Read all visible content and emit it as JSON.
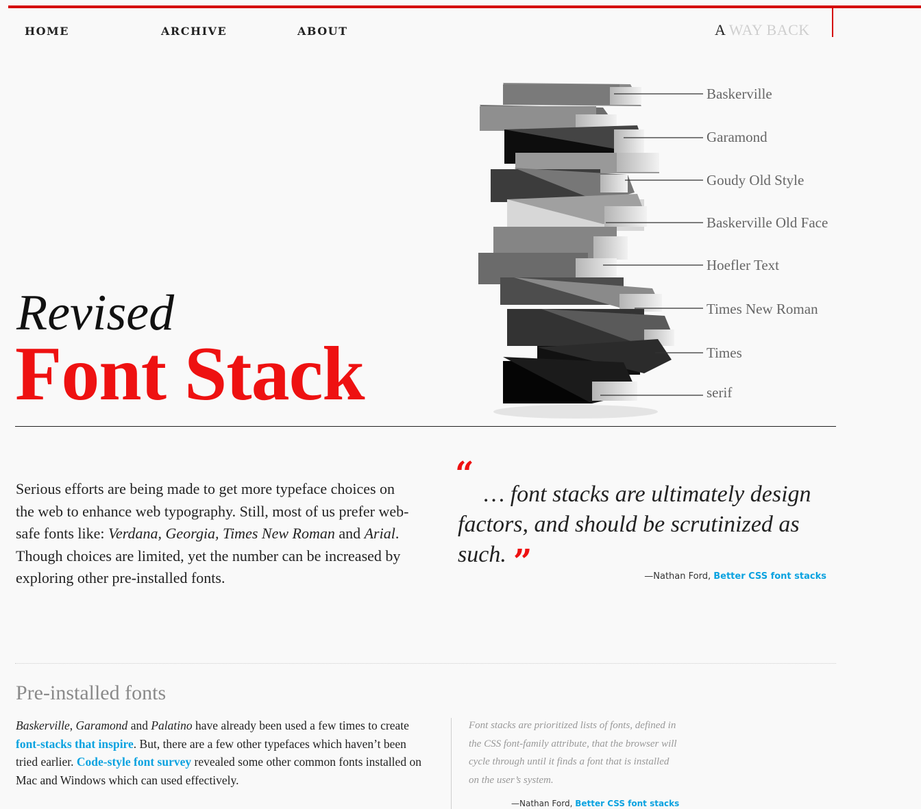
{
  "nav": {
    "items": [
      {
        "label": "HOME"
      },
      {
        "label": "ARCHIVE"
      },
      {
        "label": "ABOUT"
      }
    ],
    "wayback_first": "A",
    "wayback_rest": " WAY BACK"
  },
  "hero": {
    "title_line1": "Revised",
    "title_line2": "Font Stack",
    "fonts": [
      "Baskerville",
      "Garamond",
      "Goudy Old Style",
      "Baskerville Old Face",
      "Hoefler Text",
      "Times New Roman",
      "Times",
      "serif"
    ]
  },
  "intro": {
    "part1": "Serious efforts are being made to get more typeface choices on the web to enhance web typography. Still, most of us prefer web-safe fonts like: ",
    "em1": "Verdana, Georgia, Times New Roman",
    "part2": " and ",
    "em2": "Arial",
    "part3": ". Though choices are limited, yet the number can be increased by exploring other pre-installed fonts."
  },
  "pullquote": {
    "open_mark": "“",
    "text": "… font stacks are ultimately design factors, and should be scrutinized as such.",
    "close_mark": "”",
    "attrib_prefix": "—Nathan Ford, ",
    "attrib_link": "Better CSS font stacks"
  },
  "section": {
    "heading": "Pre-installed fonts",
    "em1": "Baskerville",
    "t1": ", ",
    "em2": "Garamond",
    "t2": " and ",
    "em3": "Palatino",
    "t3": " have already been used a few times to create ",
    "link1": "font-stacks that inspire",
    "t4": ". But, there are a few other typefaces which haven’t been tried earlier. ",
    "link2": "Code-style font survey",
    "t5": " revealed some other common fonts installed on Mac and Windows which can used effectively."
  },
  "sidenote": {
    "text": "Font stacks are prioritized lists of fonts, defined in the CSS font-family attribute, that the browser will cycle through until it finds a font that is installed on the user’s system.",
    "attrib_prefix": "—Nathan Ford, ",
    "attrib_link": "Better CSS font stacks"
  },
  "colors": {
    "accent_red": "#ee1111",
    "rule_red": "#d40000",
    "link_blue": "#0aa2e0"
  }
}
